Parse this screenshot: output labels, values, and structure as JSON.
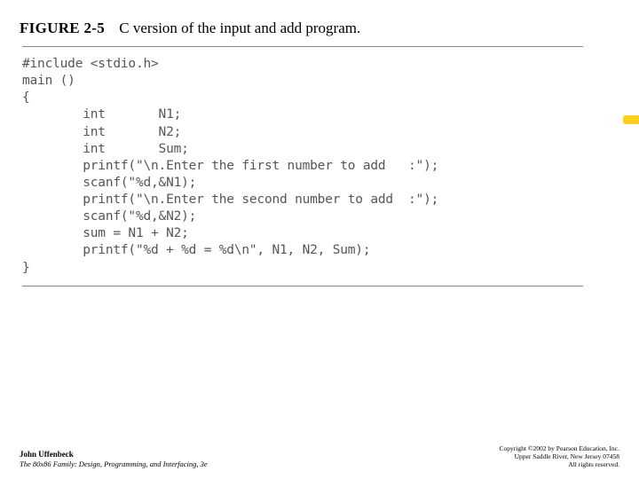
{
  "figure": {
    "label": "FIGURE 2-5",
    "caption": "C version of the input and add program."
  },
  "code": {
    "l01": "#include <stdio.h>",
    "l02": "",
    "l03": "main ()",
    "l04": "{",
    "l05": "        int       N1;",
    "l06": "        int       N2;",
    "l07": "        int       Sum;",
    "l08": "",
    "l09": "        printf(\"\\n.Enter the first number to add   :\");",
    "l10": "        scanf(\"%d,&N1);",
    "l11": "",
    "l12": "        printf(\"\\n.Enter the second number to add  :\");",
    "l13": "        scanf(\"%d,&N2);",
    "l14": "",
    "l15": "        sum = N1 + N2;",
    "l16": "",
    "l17": "        printf(\"%d + %d = %d\\n\", N1, N2, Sum);",
    "l18": "",
    "l19": "}"
  },
  "footer": {
    "author": "John Uffenbeck",
    "title": "The 80x86 Family: Design, Programming, and Interfacing, 3e",
    "copyright": "Copyright ©2002 by Pearson Education, Inc.",
    "address": "Upper Saddle River, New Jersey 07458",
    "rights": "All rights reserved."
  }
}
